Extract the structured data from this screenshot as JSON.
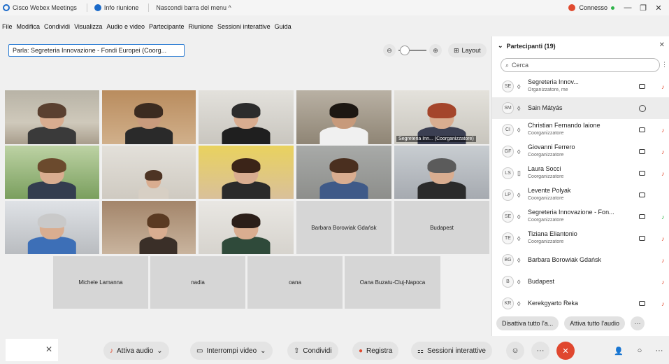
{
  "titlebar": {
    "app_name": "Cisco Webex Meetings",
    "info": "Info riunione",
    "hide_menu": "Nascondi barra del menu ^",
    "status": "Connesso",
    "win_min": "—",
    "win_max": "❐",
    "win_close": "✕"
  },
  "menu": [
    "File",
    "Modifica",
    "Condividi",
    "Visualizza",
    "Audio e video",
    "Partecipante",
    "Riunione",
    "Sessioni interattive",
    "Guida"
  ],
  "speaking": "Parla: Segreteria Innovazione - Fondi Europei (Coorg...",
  "zoom": {
    "minus": "⊖",
    "plus": "⊕"
  },
  "layout_label": "Layout",
  "tiles": {
    "active_caption": "Segreteria Inn... (Coorganizzatore)",
    "barbara": "Barbara Borowiak Gdańsk",
    "budapest": "Budapest",
    "michele": "Michele Lamanna",
    "nadia": "nadia",
    "oana": "oana",
    "oana_b": "Oana Buzatu-Cluj-Napoca"
  },
  "panel": {
    "title": "Partecipanti (19)",
    "search_placeholder": "Cerca",
    "participants": [
      {
        "initials": "SE",
        "name": "Segreteria Innov...",
        "role": "Organizzatore, me"
      },
      {
        "initials": "SM",
        "name": "Sain Mátyás",
        "role": ""
      },
      {
        "initials": "CI",
        "name": "Christian Fernando Iaione",
        "role": "Coorganizzatore"
      },
      {
        "initials": "GF",
        "name": "Giovanni Ferrero",
        "role": "Coorganizzatore"
      },
      {
        "initials": "LS",
        "name": "Laura Socci",
        "role": "Coorganizzatore"
      },
      {
        "initials": "LP",
        "name": "Levente Polyak",
        "role": "Coorganizzatore"
      },
      {
        "initials": "SE",
        "name": "Segreteria Innovazione - Fon...",
        "role": "Coorganizzatore"
      },
      {
        "initials": "TE",
        "name": "Tiziana Eliantonio",
        "role": "Coorganizzatore"
      },
      {
        "initials": "BG",
        "name": "Barbara Borowiak Gdańsk",
        "role": ""
      },
      {
        "initials": "B",
        "name": "Budapest",
        "role": ""
      },
      {
        "initials": "KR",
        "name": "Kerekgyarto Reka",
        "role": ""
      }
    ],
    "mute_all": "Disattiva tutto l'a...",
    "unmute_all": "Attiva tutto l'audio",
    "more": "···"
  },
  "controls": {
    "close": "✕",
    "audio": "Attiva audio",
    "video": "Interrompi video",
    "share": "Condividi",
    "record": "Registra",
    "breakout": "Sessioni interattive",
    "emoji": "☺",
    "more": "···",
    "end": "✕",
    "participants_icon": "👤",
    "chat_icon": "○",
    "more_right": "···"
  }
}
